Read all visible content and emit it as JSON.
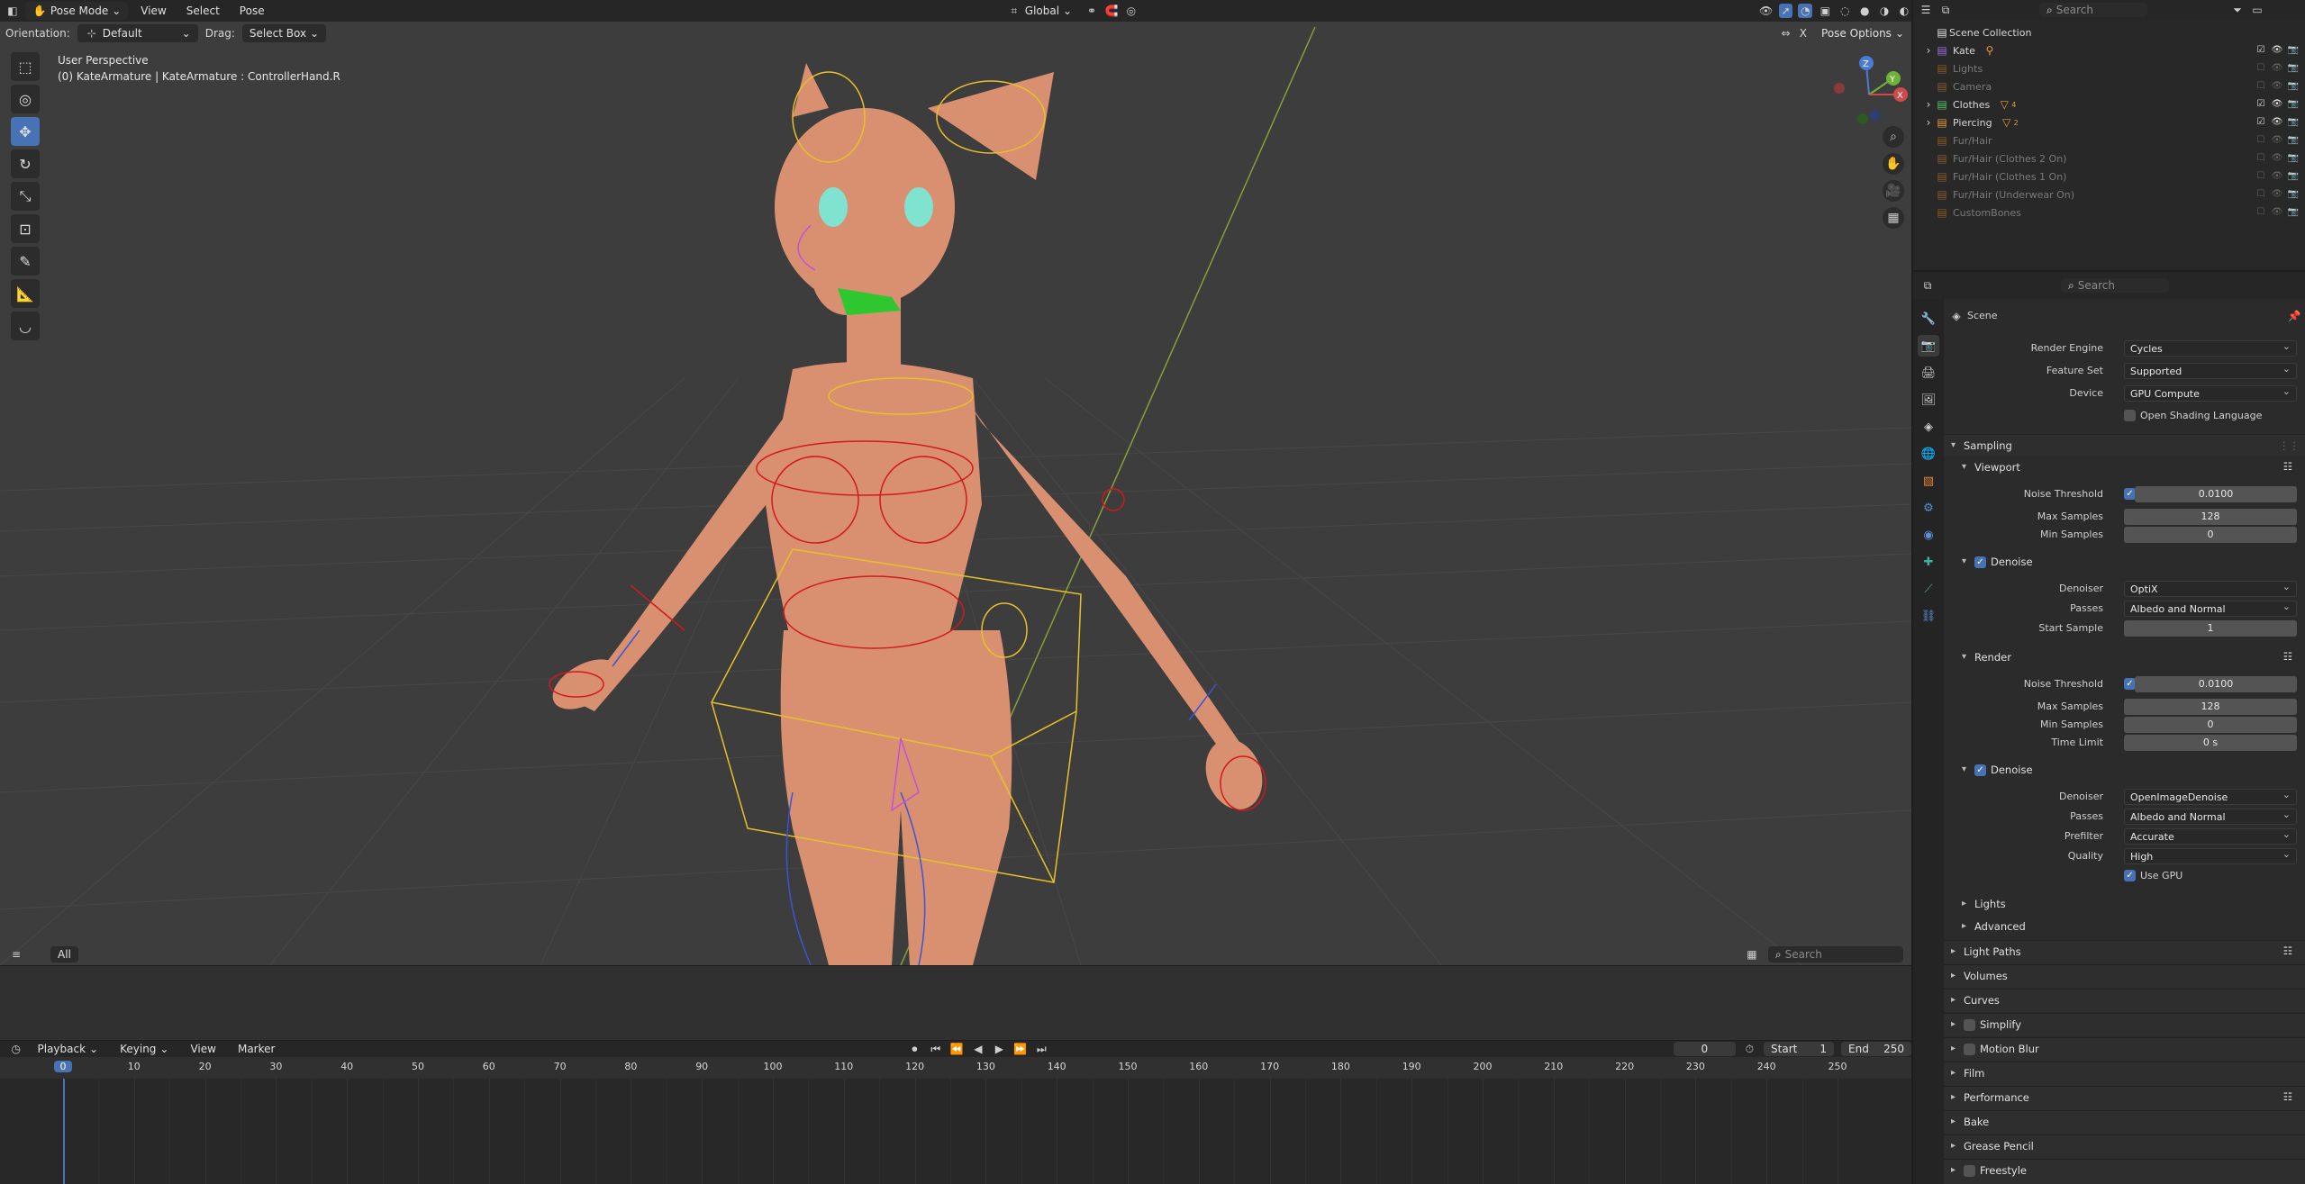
{
  "viewport": {
    "mode": "Pose Mode",
    "menus": [
      "View",
      "Select",
      "Pose"
    ],
    "transform_orientation": "Global",
    "orientation_label": "Orientation:",
    "orientation_value": "Default",
    "drag_label": "Drag:",
    "drag_value": "Select Box",
    "pose_options": "Pose Options",
    "x_label": "X",
    "info_line1": "User Perspective",
    "info_line2": "(0) KateArmature | KateArmature : ControllerHand.R",
    "gizmo_axes": [
      "Z",
      "Y",
      "X"
    ],
    "footer_tab": "All",
    "search_placeholder": "Search",
    "header_search": "Search"
  },
  "outliner": {
    "search_placeholder": "Search",
    "root": "Scene Collection",
    "items": [
      {
        "label": "Kate",
        "active": true,
        "expand": true
      },
      {
        "label": "Lights",
        "active": false,
        "expand": false
      },
      {
        "label": "Camera",
        "active": false,
        "expand": false
      },
      {
        "label": "Clothes",
        "active": true,
        "expand": true
      },
      {
        "label": "Piercing",
        "active": true,
        "expand": true
      },
      {
        "label": "Fur/Hair",
        "active": false,
        "expand": false
      },
      {
        "label": "Fur/Hair (Clothes 2 On)",
        "active": false,
        "expand": false
      },
      {
        "label": "Fur/Hair (Clothes 1 On)",
        "active": false,
        "expand": false
      },
      {
        "label": "Fur/Hair (Underwear On)",
        "active": false,
        "expand": false
      },
      {
        "label": "CustomBones",
        "active": false,
        "expand": false
      }
    ],
    "subscripts": {
      "clothes": "4",
      "piercing": "2"
    }
  },
  "properties": {
    "search_placeholder": "Search",
    "context": "Scene",
    "render_engine_label": "Render Engine",
    "render_engine": "Cycles",
    "feature_set_label": "Feature Set",
    "feature_set": "Supported",
    "device_label": "Device",
    "device": "GPU Compute",
    "osl_label": "Open Shading Language",
    "sampling": "Sampling",
    "viewport": "Viewport",
    "noise_threshold_label": "Noise Threshold",
    "vp_noise_threshold": "0.0100",
    "max_samples_label": "Max Samples",
    "vp_max_samples": "128",
    "min_samples_label": "Min Samples",
    "vp_min_samples": "0",
    "denoise": "Denoise",
    "denoiser_label": "Denoiser",
    "vp_denoiser": "OptiX",
    "passes_label": "Passes",
    "vp_passes": "Albedo and Normal",
    "start_sample_label": "Start Sample",
    "vp_start_sample": "1",
    "render": "Render",
    "r_noise_threshold": "0.0100",
    "r_max_samples": "128",
    "r_min_samples": "0",
    "time_limit_label": "Time Limit",
    "r_time_limit": "0 s",
    "r_denoiser": "OpenImageDenoise",
    "r_passes": "Albedo and Normal",
    "prefilter_label": "Prefilter",
    "r_prefilter": "Accurate",
    "quality_label": "Quality",
    "r_quality": "High",
    "use_gpu_label": "Use GPU",
    "sub_lights": "Lights",
    "sub_advanced": "Advanced",
    "panels": [
      "Light Paths",
      "Volumes",
      "Curves",
      "Simplify",
      "Motion Blur",
      "Film",
      "Performance",
      "Bake",
      "Grease Pencil",
      "Freestyle"
    ]
  },
  "timeline": {
    "menus": [
      "Playback",
      "Keying",
      "View",
      "Marker"
    ],
    "current_frame": "0",
    "start_label": "Start",
    "start": "1",
    "end_label": "End",
    "end": "250",
    "ticks": [
      "0",
      "10",
      "20",
      "30",
      "40",
      "50",
      "60",
      "70",
      "80",
      "90",
      "100",
      "110",
      "120",
      "130",
      "140",
      "150",
      "160",
      "170",
      "180",
      "190",
      "200",
      "210",
      "220",
      "230",
      "240",
      "250"
    ]
  },
  "colors": {
    "accent": "#4772b3",
    "rig_red": "#d11a1a",
    "rig_yellow": "#e8c02a",
    "rig_blue": "#3a55d6",
    "skin": "#d99070"
  }
}
